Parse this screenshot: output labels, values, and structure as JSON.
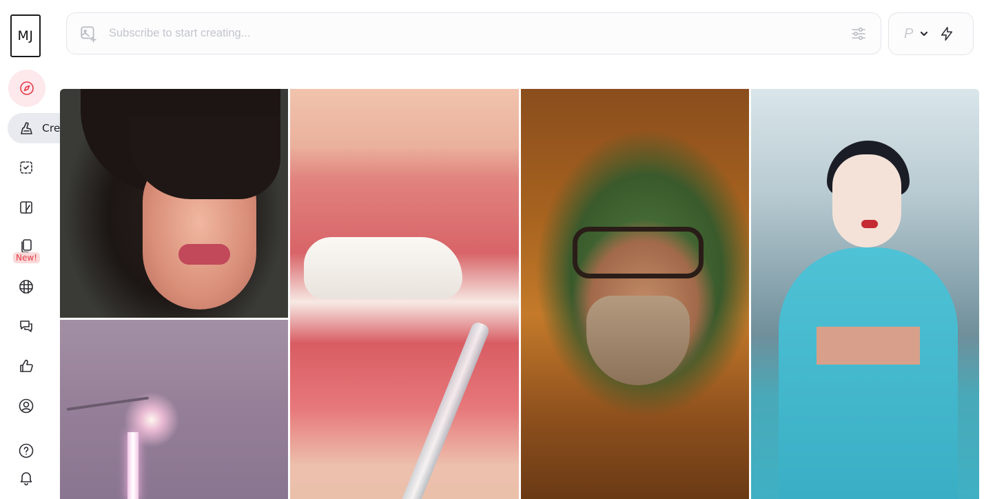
{
  "sidebar": {
    "logo": "MJ",
    "create_label": "Create",
    "new_badge": "New!",
    "items": [
      {
        "name": "explore",
        "icon": "compass-icon",
        "active": true
      },
      {
        "name": "create",
        "icon": "brush-hand-icon"
      },
      {
        "name": "edit",
        "icon": "dashed-square-icon"
      },
      {
        "name": "personalize",
        "icon": "split-square-icon"
      },
      {
        "name": "moodboards",
        "icon": "stacked-cards-icon",
        "badge": "New!"
      },
      {
        "name": "organize",
        "icon": "grid-icon"
      },
      {
        "name": "chat",
        "icon": "chat-bubbles-icon"
      },
      {
        "name": "tasks",
        "icon": "thumbs-up-icon"
      },
      {
        "name": "profile",
        "icon": "user-circle-icon"
      },
      {
        "name": "help",
        "icon": "question-circle-icon"
      },
      {
        "name": "updates",
        "icon": "bell-icon"
      }
    ]
  },
  "prompt": {
    "placeholder": "Subscribe to start creating...",
    "value": ""
  },
  "mode": {
    "label": "P"
  },
  "colors": {
    "accent": "#e53946",
    "active_bg": "#fde8ec",
    "pill_bg": "#e9eaef",
    "border": "#e3e4ea"
  },
  "gallery": [
    {
      "id": "woman-portrait"
    },
    {
      "id": "glossy-lips"
    },
    {
      "id": "bearded-man-glasses"
    },
    {
      "id": "geisha-scooter"
    },
    {
      "id": "foggy-street-sign"
    }
  ]
}
